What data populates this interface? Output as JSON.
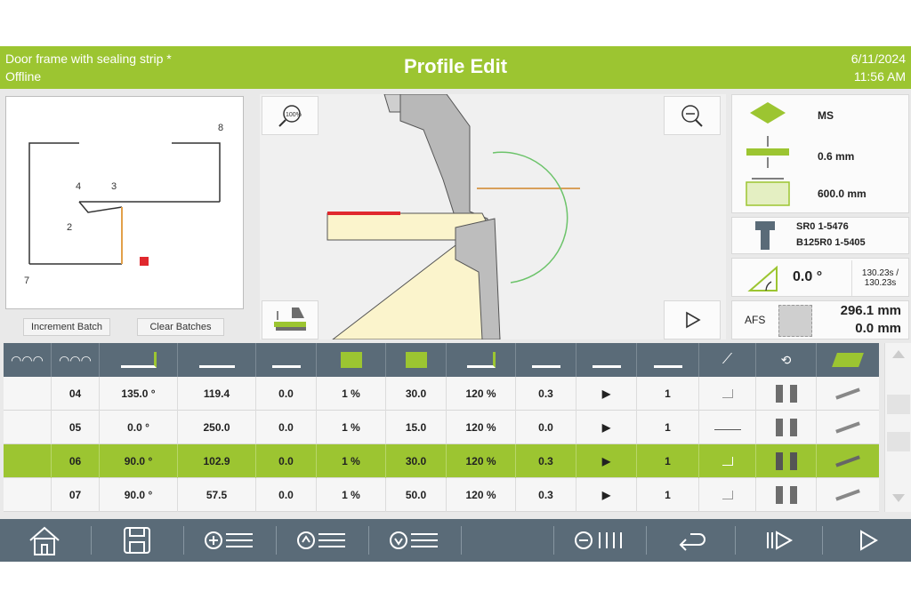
{
  "header": {
    "program_name": "Door frame with sealing strip *",
    "status": "Offline",
    "title": "Profile Edit",
    "date": "6/11/2024",
    "time": "11:56 AM"
  },
  "preview": {
    "labels": [
      "8",
      "4",
      "3",
      "2",
      "7"
    ],
    "buttons": {
      "increment_batch": "Increment Batch",
      "clear_batches": "Clear Batches"
    }
  },
  "material": {
    "name": "MS",
    "thickness": "0.6 mm",
    "length": "600.0 mm"
  },
  "tools": {
    "upper": "SR0 1-5476",
    "lower": "B125R0 1-5405"
  },
  "angle": {
    "value": "0.0 °",
    "times": "130.23s / 130.23s"
  },
  "afs": {
    "label": "AFS",
    "value1": "296.1 mm",
    "value2": "0.0 mm"
  },
  "table": {
    "rows": [
      {
        "id": "04",
        "angle": "135.0 °",
        "bg": "119.4",
        "r": "0.0",
        "pct1": "1 %",
        "h": "30.0",
        "pct2": "120 %",
        "d": "0.3",
        "play": "▶",
        "n": "1",
        "selected": false
      },
      {
        "id": "05",
        "angle": "0.0 °",
        "bg": "250.0",
        "r": "0.0",
        "pct1": "1 %",
        "h": "15.0",
        "pct2": "120 %",
        "d": "0.0",
        "play": "▶",
        "n": "1",
        "selected": false
      },
      {
        "id": "06",
        "angle": "90.0 °",
        "bg": "102.9",
        "r": "0.0",
        "pct1": "1 %",
        "h": "30.0",
        "pct2": "120 %",
        "d": "0.3",
        "play": "▶",
        "n": "1",
        "selected": true
      },
      {
        "id": "07",
        "angle": "90.0 °",
        "bg": "57.5",
        "r": "0.0",
        "pct1": "1 %",
        "h": "50.0",
        "pct2": "120 %",
        "d": "0.3",
        "play": "▶",
        "n": "1",
        "selected": false
      }
    ]
  },
  "toolbar": {
    "icons": [
      "home-icon",
      "save-icon",
      "add-step-icon",
      "move-up-icon",
      "move-down-icon",
      "blank",
      "delete-icon",
      "undo-icon",
      "step-forward-icon",
      "play-icon"
    ]
  },
  "colors": {
    "accent": "#9cc531",
    "toolbar": "#5a6b78",
    "highlight_red": "#e0282e"
  }
}
